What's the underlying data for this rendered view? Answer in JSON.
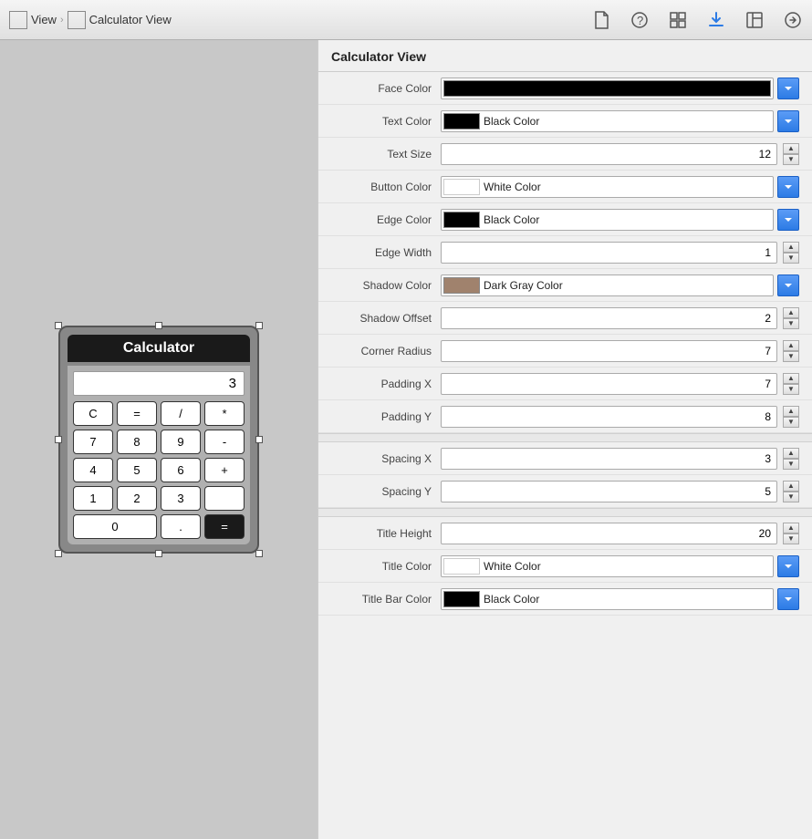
{
  "toolbar": {
    "breadcrumb": [
      {
        "label": "View",
        "icon": "view-icon"
      },
      {
        "label": "Calculator View",
        "icon": "calculator-view-icon"
      }
    ],
    "icons": [
      {
        "name": "file-icon",
        "symbol": "📄",
        "active": false
      },
      {
        "name": "help-icon",
        "symbol": "?",
        "active": false
      },
      {
        "name": "grid-icon",
        "symbol": "⊞",
        "active": false
      },
      {
        "name": "download-icon",
        "symbol": "↓",
        "active": true
      },
      {
        "name": "inspector-icon",
        "symbol": "≡",
        "active": false
      },
      {
        "name": "navigate-icon",
        "symbol": "→",
        "active": false
      }
    ]
  },
  "calculator": {
    "title": "Calculator",
    "display": "3",
    "buttons": [
      {
        "label": "C",
        "dark": false
      },
      {
        "label": "=",
        "dark": false
      },
      {
        "label": "/",
        "dark": false
      },
      {
        "label": "*",
        "dark": false
      },
      {
        "label": "7",
        "dark": false
      },
      {
        "label": "8",
        "dark": false
      },
      {
        "label": "9",
        "dark": false
      },
      {
        "label": "-",
        "dark": false
      },
      {
        "label": "4",
        "dark": false
      },
      {
        "label": "5",
        "dark": false
      },
      {
        "label": "6",
        "dark": false
      },
      {
        "label": "+",
        "dark": false
      },
      {
        "label": "1",
        "dark": false
      },
      {
        "label": "2",
        "dark": false
      },
      {
        "label": "3",
        "dark": false
      },
      {
        "label": "",
        "dark": false
      },
      {
        "label": "0",
        "dark": false,
        "wide": true
      },
      {
        "label": ".",
        "dark": false
      },
      {
        "label": "=",
        "dark": true
      }
    ]
  },
  "properties": {
    "title": "Calculator View",
    "rows": [
      {
        "label": "Face Color",
        "type": "color-only",
        "swatch": "black",
        "swatchDisplay": "#000000"
      },
      {
        "label": "Text Color",
        "type": "color-dropdown",
        "swatch": "#000000",
        "colorName": "Black Color"
      },
      {
        "label": "Text Size",
        "type": "number-stepper",
        "value": "12"
      },
      {
        "label": "Button Color",
        "type": "color-dropdown",
        "swatch": "#ffffff",
        "colorName": "White Color"
      },
      {
        "label": "Edge Color",
        "type": "color-dropdown",
        "swatch": "#000000",
        "colorName": "Black Color"
      },
      {
        "label": "Edge Width",
        "type": "number-stepper",
        "value": "1"
      },
      {
        "label": "Shadow Color",
        "type": "color-dropdown",
        "swatch": "#a0826d",
        "colorName": "Dark Gray Color"
      },
      {
        "label": "Shadow Offset",
        "type": "number-stepper",
        "value": "2"
      },
      {
        "label": "Corner Radius",
        "type": "number-stepper",
        "value": "7"
      },
      {
        "label": "Padding X",
        "type": "number-stepper",
        "value": "7"
      },
      {
        "label": "Padding Y",
        "type": "number-stepper",
        "value": "8"
      },
      {
        "label": "Spacing X",
        "type": "number-stepper",
        "value": "3"
      },
      {
        "label": "Spacing Y",
        "type": "number-stepper",
        "value": "5"
      },
      {
        "label": "Title Height",
        "type": "number-stepper",
        "value": "20"
      },
      {
        "label": "Title Color",
        "type": "color-dropdown",
        "swatch": "#ffffff",
        "colorName": "White Color"
      },
      {
        "label": "Title Bar Color",
        "type": "color-dropdown",
        "swatch": "#000000",
        "colorName": "Black Color"
      }
    ]
  }
}
